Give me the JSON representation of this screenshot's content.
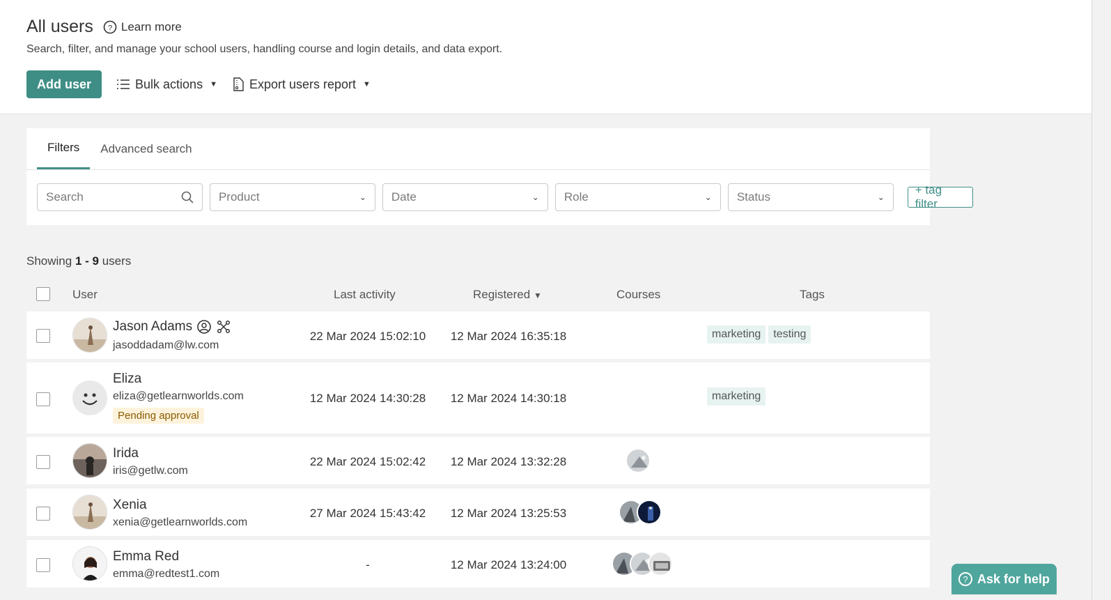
{
  "header": {
    "title": "All users",
    "learn_more": "Learn more",
    "subtitle": "Search, filter, and manage your school users, handling course and login details, and data export.",
    "add_user": "Add user",
    "bulk_actions": "Bulk actions",
    "export_report": "Export users report"
  },
  "filters": {
    "tabs": [
      "Filters",
      "Advanced search"
    ],
    "search_placeholder": "Search",
    "product": "Product",
    "date": "Date",
    "role": "Role",
    "status": "Status",
    "tag_filter": "+ tag filter"
  },
  "showing": {
    "prefix": "Showing",
    "range": "1 - 9",
    "suffix": "users"
  },
  "columns": {
    "user": "User",
    "last_activity": "Last activity",
    "registered": "Registered",
    "registered_sort": "▼",
    "courses": "Courses",
    "tags": "Tags"
  },
  "users": [
    {
      "name": "Jason Adams",
      "email": "jasoddadam@lw.com",
      "last_activity": "22 Mar 2024 15:02:10",
      "registered": "12 Mar 2024 16:35:18",
      "tags": [
        "marketing",
        "testing"
      ],
      "courses": 0,
      "icons": [
        "admin-icon",
        "affiliate-icon"
      ]
    },
    {
      "name": "Eliza",
      "email": "eliza@getlearnworlds.com",
      "status": "Pending approval",
      "last_activity": "12 Mar 2024 14:30:28",
      "registered": "12 Mar 2024 14:30:18",
      "tags": [
        "marketing"
      ],
      "courses": 0
    },
    {
      "name": "Irida",
      "email": "iris@getlw.com",
      "last_activity": "22 Mar 2024 15:02:42",
      "registered": "12 Mar 2024 13:32:28",
      "tags": [],
      "courses": 1
    },
    {
      "name": "Xenia",
      "email": "xenia@getlearnworlds.com",
      "last_activity": "27 Mar 2024 15:43:42",
      "registered": "12 Mar 2024 13:25:53",
      "tags": [],
      "courses": 2
    },
    {
      "name": "Emma Red",
      "email": "emma@redtest1.com",
      "last_activity": "-",
      "registered": "12 Mar 2024 13:24:00",
      "tags": [],
      "courses": 3
    }
  ],
  "help": {
    "label": "Ask for help"
  },
  "colors": {
    "accent": "#3f8e86",
    "tag_bg": "#e6f3f1",
    "pending_bg": "#fdf3dc"
  }
}
